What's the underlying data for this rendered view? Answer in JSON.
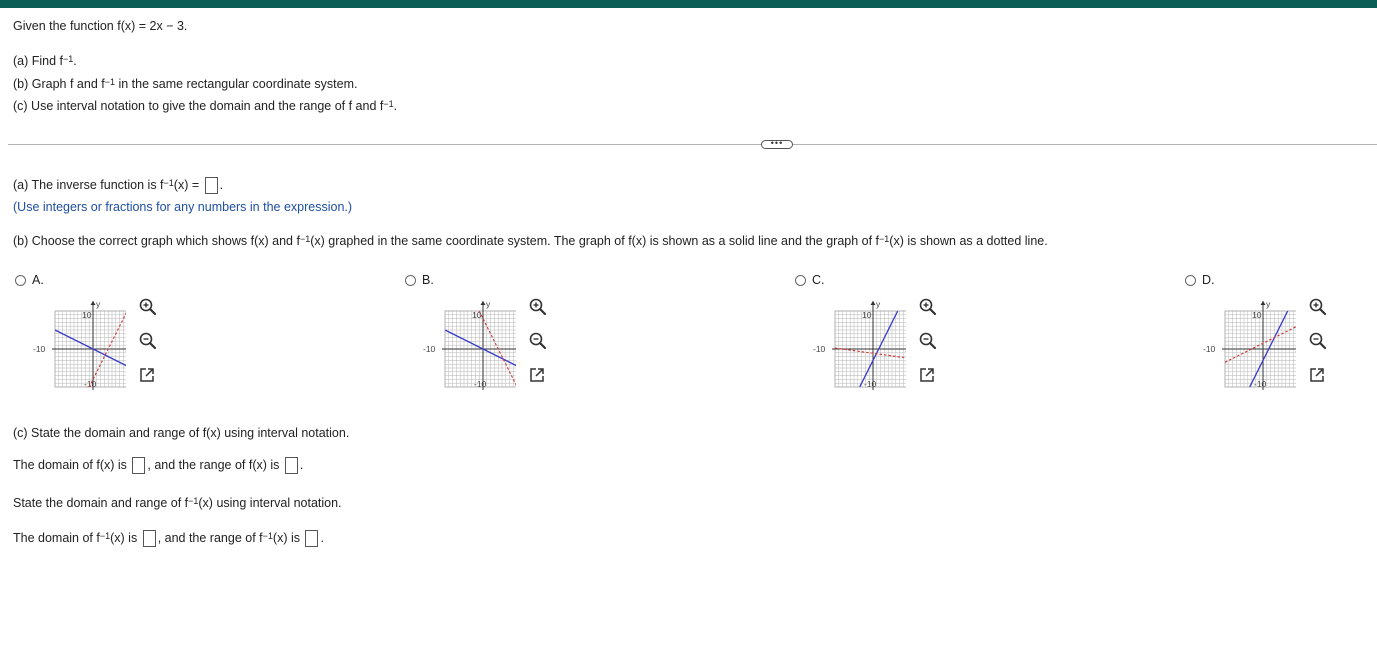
{
  "colors": {
    "header_bar": "#0b5e55",
    "hint": "#1f4fa3",
    "solid_line": "#3a3acb",
    "dotted_line": "#d23c3c"
  },
  "question": {
    "intro": "Given the function f(x) = 2x − 3.",
    "part_a_prefix": "(a) Find f",
    "part_a_suffix": ".",
    "part_b_prefix": "(b) Graph f and f",
    "part_b_suffix": " in the same rectangular coordinate system.",
    "part_c_prefix": "(c) Use interval notation to give the domain and the range of f and f",
    "part_c_suffix": ".",
    "exponent": "−1"
  },
  "more_button": "•••",
  "answer_a": {
    "prefix": "(a) The inverse function is f",
    "middle": "(x) = ",
    "suffix": ".",
    "hint": "(Use integers or fractions for any numbers in the expression.)"
  },
  "answer_b": {
    "prefix": "(b) Choose the correct graph which shows f(x) and f",
    "middle": "(x) graphed in the same coordinate system. The graph of f(x) is shown as a solid line and the graph of f",
    "suffix": "(x) is shown as a dotted line."
  },
  "options": [
    {
      "label": "A.",
      "solid": [
        [
          -10,
          5
        ],
        [
          10,
          -5
        ]
      ],
      "dotted": [
        [
          -1,
          -10
        ],
        [
          9,
          10
        ]
      ]
    },
    {
      "label": "B.",
      "solid": [
        [
          -10,
          5
        ],
        [
          10,
          -5
        ]
      ],
      "dotted": [
        [
          -1,
          10
        ],
        [
          9,
          -10
        ]
      ]
    },
    {
      "label": "C.",
      "solid": [
        [
          -3.5,
          -10
        ],
        [
          6.5,
          10
        ]
      ],
      "dotted": [
        [
          -10,
          0.25
        ],
        [
          10,
          -2.5
        ]
      ]
    },
    {
      "label": "D.",
      "solid": [
        [
          -3.5,
          -10
        ],
        [
          6.5,
          10
        ]
      ],
      "dotted": [
        [
          -10,
          -3.5
        ],
        [
          10,
          6.5
        ]
      ]
    }
  ],
  "graph": {
    "xmin": -10,
    "xmax": 10,
    "ymin": -10,
    "ymax": 10,
    "x_label": "x",
    "y_label": "y",
    "tick_min": "-10",
    "tick_max": "10",
    "grid": true
  },
  "icons": {
    "zoom_in": "zoom-in-icon",
    "zoom_out": "zoom-out-icon",
    "popout": "popout-icon"
  },
  "answer_c": {
    "line1": "(c) State the domain and range of f(x) using interval notation.",
    "line2_prefix": "The domain of f(x) is ",
    "line2_middle": ", and the range of f(x) is ",
    "line2_suffix": ".",
    "line3_prefix": "State the domain and range of f",
    "line3_suffix": "(x) using interval notation.",
    "line4_prefix": "The domain of f",
    "line4_middle1": "(x) is ",
    "line4_middle2": ", and the range of f",
    "line4_middle3": "(x) is ",
    "line4_suffix": "."
  }
}
